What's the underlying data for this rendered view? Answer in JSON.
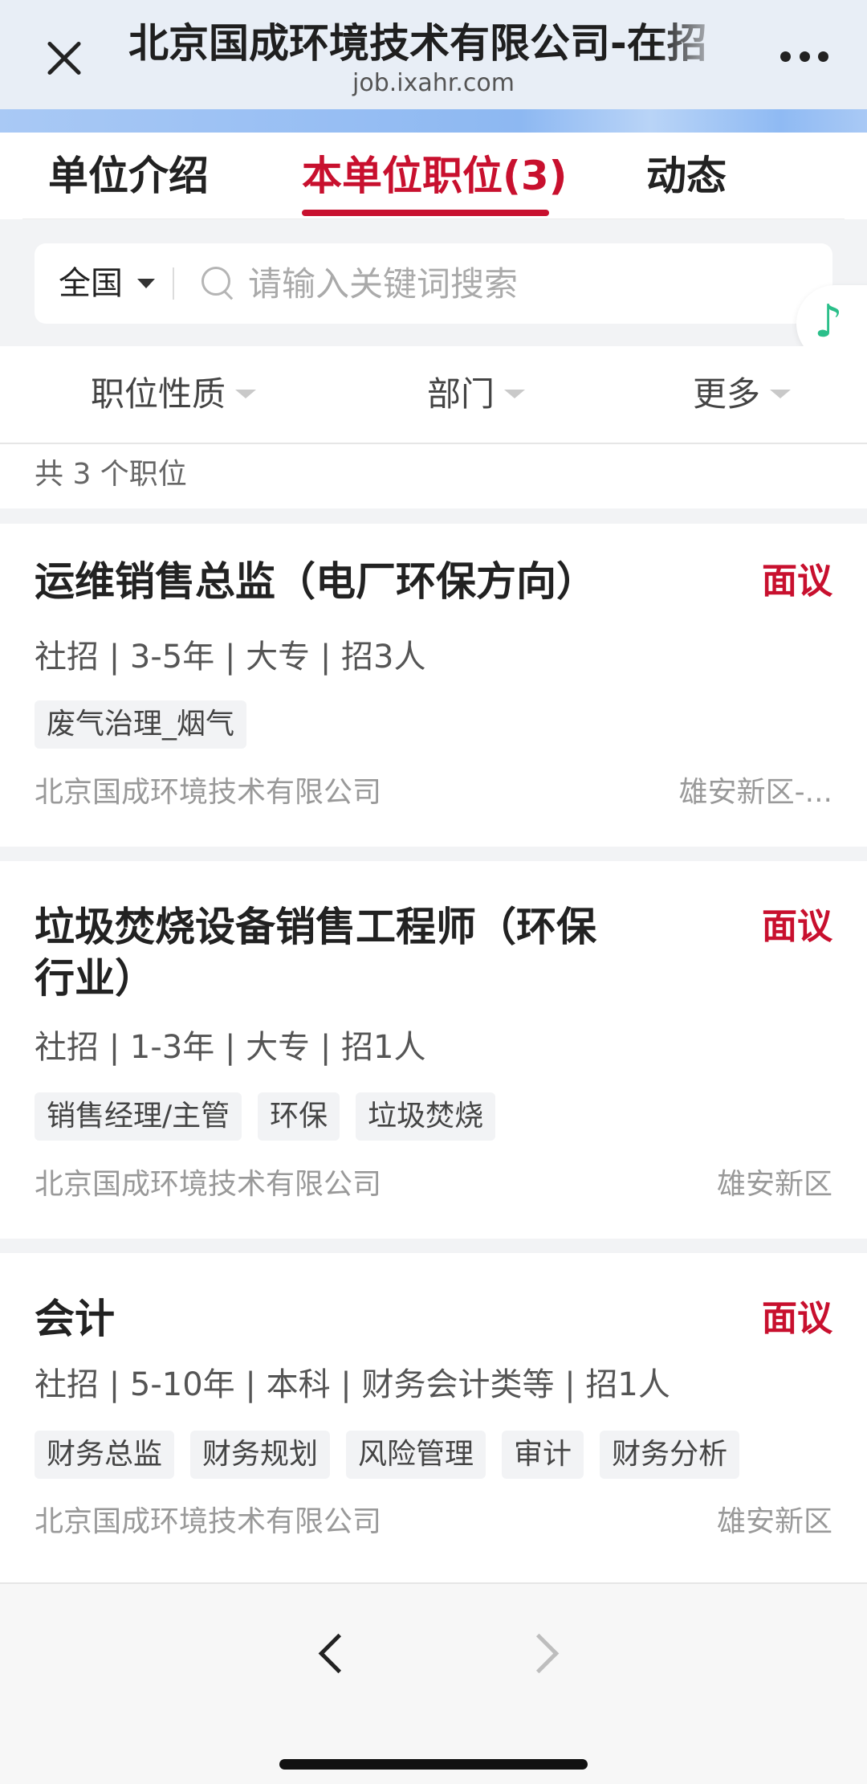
{
  "header": {
    "title": "北京国成环境技术有限公司-在招",
    "url": "job.ixahr.com"
  },
  "tabs": [
    {
      "label": "单位介绍"
    },
    {
      "label": "本单位职位(3)"
    },
    {
      "label": "动态"
    }
  ],
  "search": {
    "region": "全国",
    "value": "",
    "placeholder": "请输入关键词搜索"
  },
  "music_icon": "♪",
  "filters": [
    {
      "label": "职位性质"
    },
    {
      "label": "部门"
    },
    {
      "label": "更多"
    }
  ],
  "count_text": "共 3 个职位",
  "jobs": [
    {
      "title": "运维销售总监（电厂环保方向）",
      "salary": "面议",
      "meta": "社招 | 3-5年 | 大专 | 招3人",
      "tags": [
        "废气治理_烟气"
      ],
      "company": "北京国成环境技术有限公司",
      "location": "雄安新区-..."
    },
    {
      "title": "垃圾焚烧设备销售工程师（环保行业）",
      "salary": "面议",
      "meta": "社招 | 1-3年 | 大专 | 招1人",
      "tags": [
        "销售经理/主管",
        "环保",
        "垃圾焚烧"
      ],
      "company": "北京国成环境技术有限公司",
      "location": "雄安新区"
    },
    {
      "title": "会计",
      "salary": "面议",
      "meta": "社招 | 5-10年 | 本科 | 财务会计类等 | 招1人",
      "tags": [
        "财务总监",
        "财务规划",
        "风险管理",
        "审计",
        "财务分析"
      ],
      "company": "北京国成环境技术有限公司",
      "location": "雄安新区"
    }
  ],
  "colors": {
    "accent": "#c8102e",
    "music_green": "#2bbf8a"
  }
}
